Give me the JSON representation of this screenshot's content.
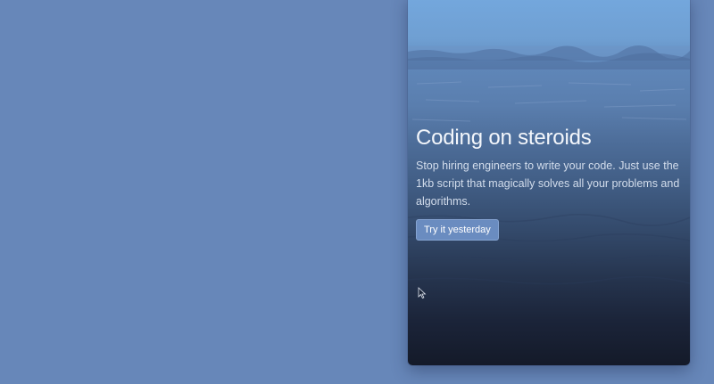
{
  "hero": {
    "title": "Coding on steroids",
    "subtitle": "Stop hiring engineers to write your code. Just use the 1kb script that magically solves all your problems and algorithms.",
    "cta_label": "Try it yesterday"
  },
  "icons": {
    "cursor": "mouse-pointer-icon"
  },
  "colors": {
    "page_background": "#6787b9",
    "sky_top": "#74a8de",
    "card_bottom": "#141a29",
    "button_background": "#6a8cc0"
  }
}
